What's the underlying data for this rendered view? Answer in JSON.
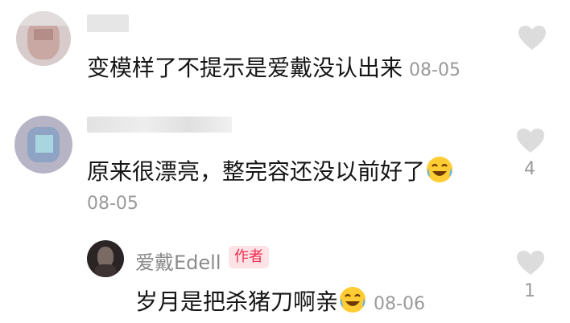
{
  "comments": [
    {
      "text": "变模样了不提示是爱戴没认出来",
      "date": "08-05",
      "likes": ""
    },
    {
      "text": "原来很漂亮，整完容还没以前好了",
      "date": "08-05",
      "likes": "4"
    }
  ],
  "reply": {
    "author": "爱戴Edell",
    "badge": "作者",
    "text": "岁月是把杀猪刀啊亲",
    "date": "08-06",
    "likes": "1"
  },
  "icons": {
    "like": "heart-outline-icon",
    "emoji": "crying-laughing-emoji"
  },
  "colors": {
    "text": "#161616",
    "meta": "#9a9a9a",
    "badge_bg": "#fde3e6",
    "badge_text": "#ee2c4e",
    "heart": "#dcdcdc"
  }
}
